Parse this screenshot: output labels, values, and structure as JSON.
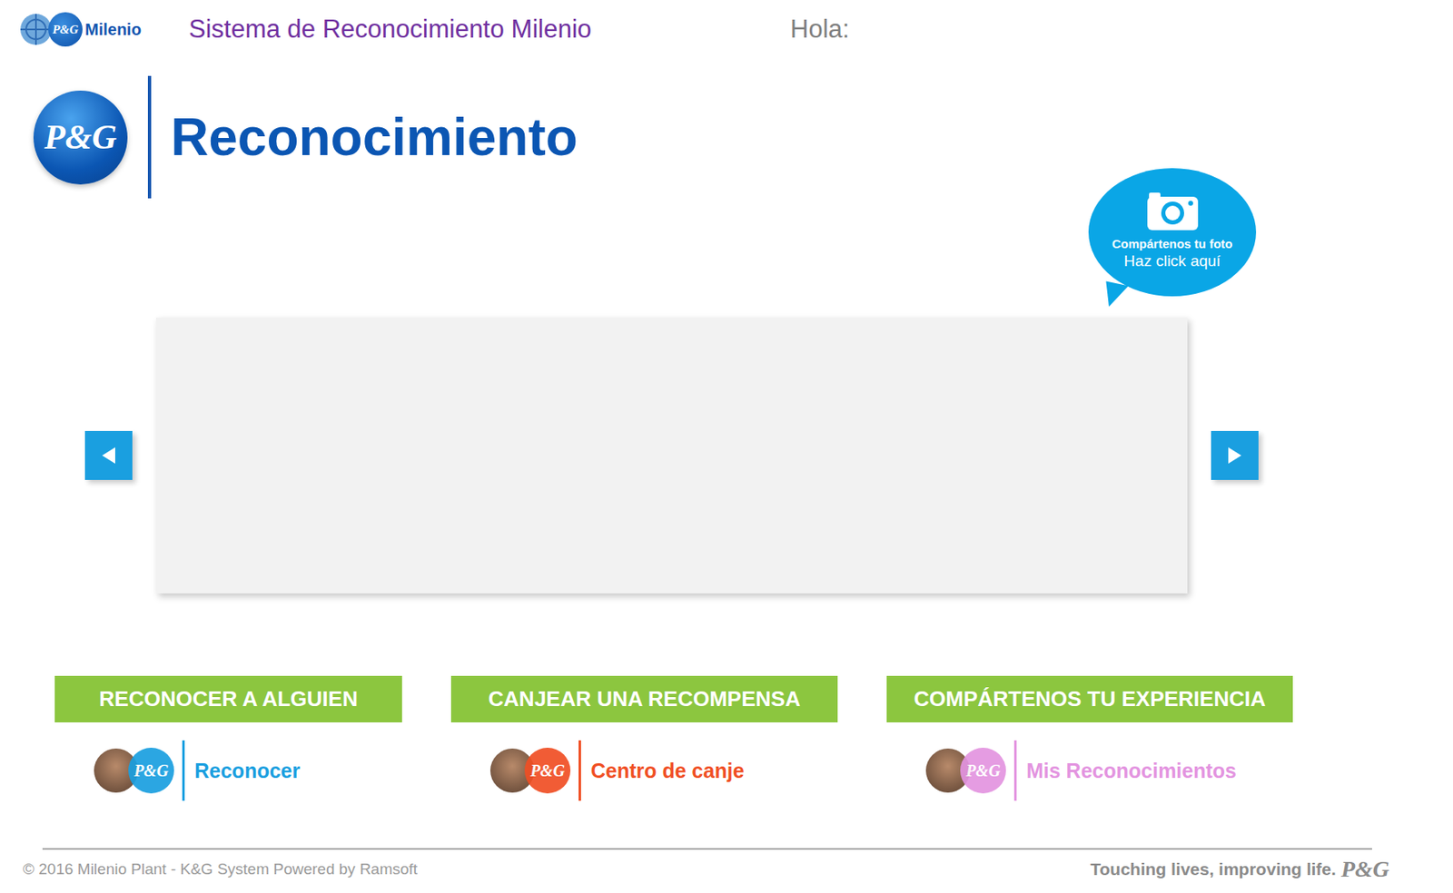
{
  "header": {
    "logo_text": "P&G",
    "brand": "Milenio",
    "title": "Sistema de Reconocimiento Milenio",
    "greeting": "Hola:"
  },
  "hero": {
    "logo_text": "P&G",
    "title": "Reconocimiento"
  },
  "photo_bubble": {
    "line1": "Compártenos tu foto",
    "line2": "Haz click aquí"
  },
  "actions": [
    {
      "button": "RECONOCER A ALGUIEN",
      "link": "Reconocer",
      "logo_text": "P&G",
      "color": "#1a9fe0"
    },
    {
      "button": "CANJEAR UNA RECOMPENSA",
      "link": "Centro de canje",
      "logo_text": "P&G",
      "color": "#f04f24"
    },
    {
      "button": "COMPÁRTENOS TU EXPERIENCIA",
      "link": "Mis Reconocimientos",
      "logo_text": "P&G",
      "color": "#e394e0"
    }
  ],
  "footer": {
    "copyright": "© 2016 Milenio Plant - K&G System Powered by Ramsoft",
    "tagline": "Touching lives, improving life.",
    "logo_text": "P&G"
  }
}
